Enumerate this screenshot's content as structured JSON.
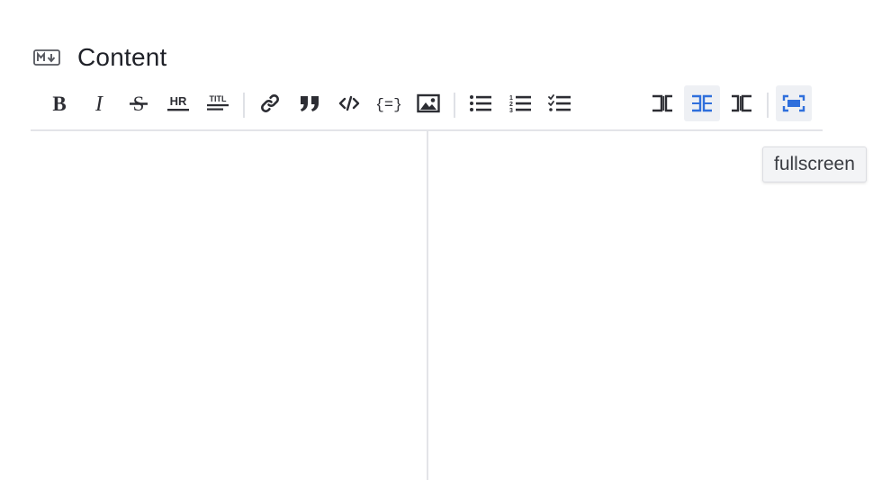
{
  "field": {
    "icon": "markdown-icon",
    "title": "Content"
  },
  "toolbar": {
    "groups": [
      [
        "bold-icon",
        "italic-icon",
        "strikethrough-icon",
        "horizontal-rule-icon",
        "heading-icon"
      ],
      [
        "link-icon",
        "quote-icon",
        "code-icon",
        "code-block-icon",
        "image-icon"
      ],
      [
        "unordered-list-icon",
        "ordered-list-icon",
        "task-list-icon"
      ],
      [
        "edit-mode-icon",
        "split-view-icon",
        "preview-mode-icon"
      ],
      [
        "fullscreen-icon"
      ]
    ],
    "hr_text": "HR",
    "heading_text": "TITL",
    "active_view": "split-view",
    "fullscreen_highlighted": true
  },
  "tooltip": {
    "text": "fullscreen"
  },
  "colors": {
    "accent": "#2f6fdc",
    "icon": "#2c2d33",
    "active_bg": "#eef0f4"
  }
}
